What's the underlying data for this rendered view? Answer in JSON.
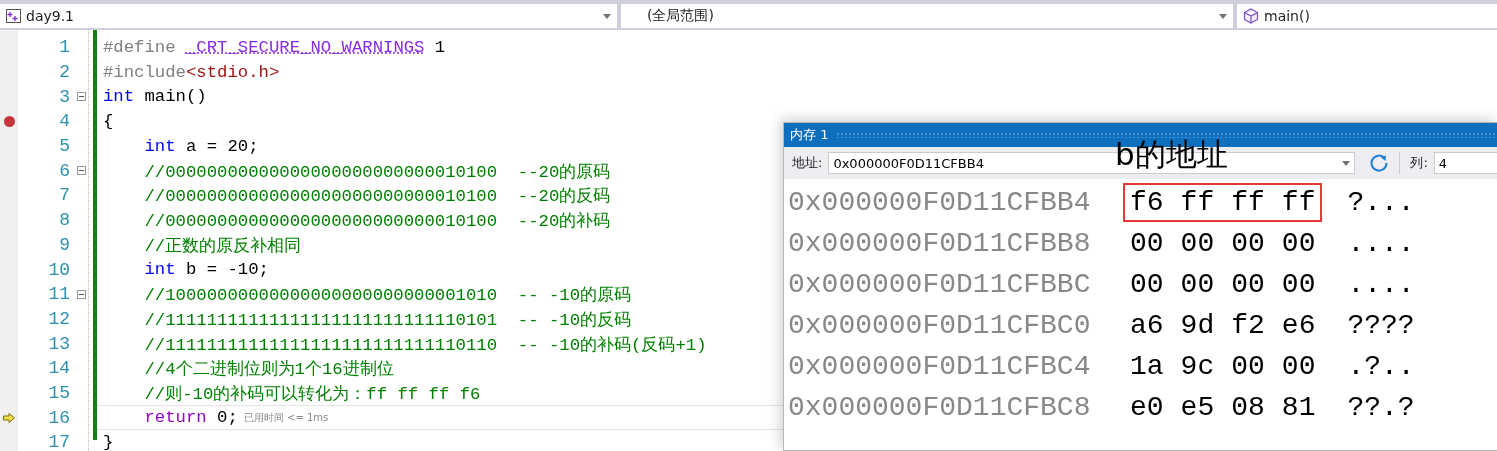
{
  "navigation_bar": {
    "project": "day9.1",
    "scope": "(全局范围)",
    "function": "main()"
  },
  "editor": {
    "lines": [
      {
        "number": "1",
        "breakpoint": false,
        "current": false,
        "foldable": false,
        "segments": [
          {
            "text": "#define ",
            "kind": "preprocessor"
          },
          {
            "text": "_CRT_SECURE_NO_WARNINGS",
            "kind": "macro"
          },
          {
            "text": " 1",
            "kind": "plain"
          }
        ]
      },
      {
        "number": "2",
        "breakpoint": false,
        "current": false,
        "foldable": false,
        "segments": [
          {
            "text": "#include",
            "kind": "preprocessor"
          },
          {
            "text": "<stdio.h>",
            "kind": "string"
          }
        ]
      },
      {
        "number": "3",
        "breakpoint": false,
        "current": false,
        "foldable": true,
        "segments": [
          {
            "text": "int",
            "kind": "keyword"
          },
          {
            "text": " main()",
            "kind": "plain"
          }
        ]
      },
      {
        "number": "4",
        "breakpoint": true,
        "current": false,
        "foldable": false,
        "segments": [
          {
            "text": "{",
            "kind": "plain"
          }
        ]
      },
      {
        "number": "5",
        "breakpoint": false,
        "current": false,
        "foldable": false,
        "segments": [
          {
            "text": "    int",
            "kind": "keyword"
          },
          {
            "text": " a = 20;",
            "kind": "plain"
          }
        ]
      },
      {
        "number": "6",
        "breakpoint": false,
        "current": false,
        "foldable": true,
        "segments": [
          {
            "text": "    //00000000000000000000000000010100  --20的原码",
            "kind": "comment"
          }
        ]
      },
      {
        "number": "7",
        "breakpoint": false,
        "current": false,
        "foldable": false,
        "segments": [
          {
            "text": "    //00000000000000000000000000010100  --20的反码",
            "kind": "comment"
          }
        ]
      },
      {
        "number": "8",
        "breakpoint": false,
        "current": false,
        "foldable": false,
        "segments": [
          {
            "text": "    //00000000000000000000000000010100  --20的补码",
            "kind": "comment"
          }
        ]
      },
      {
        "number": "9",
        "breakpoint": false,
        "current": false,
        "foldable": false,
        "segments": [
          {
            "text": "    //正数的原反补相同",
            "kind": "comment"
          }
        ]
      },
      {
        "number": "10",
        "breakpoint": false,
        "current": false,
        "foldable": false,
        "segments": [
          {
            "text": "    int",
            "kind": "keyword"
          },
          {
            "text": " b = -10;",
            "kind": "plain"
          }
        ]
      },
      {
        "number": "11",
        "breakpoint": false,
        "current": false,
        "foldable": true,
        "segments": [
          {
            "text": "    //10000000000000000000000000001010  -- -10的原码",
            "kind": "comment"
          }
        ]
      },
      {
        "number": "12",
        "breakpoint": false,
        "current": false,
        "foldable": false,
        "segments": [
          {
            "text": "    //11111111111111111111111111110101  -- -10的反码",
            "kind": "comment"
          }
        ]
      },
      {
        "number": "13",
        "breakpoint": false,
        "current": false,
        "foldable": false,
        "segments": [
          {
            "text": "    //11111111111111111111111111110110  -- -10的补码(反码+1)",
            "kind": "comment"
          }
        ]
      },
      {
        "number": "14",
        "breakpoint": false,
        "current": false,
        "foldable": false,
        "segments": [
          {
            "text": "    //4个二进制位则为1个16进制位",
            "kind": "comment"
          }
        ]
      },
      {
        "number": "15",
        "breakpoint": false,
        "current": false,
        "foldable": false,
        "segments": [
          {
            "text": "    //则-10的补码可以转化为：ff ff ff f6",
            "kind": "comment"
          }
        ]
      },
      {
        "number": "16",
        "breakpoint": false,
        "current": true,
        "foldable": false,
        "hint": "已用时间 <= 1ms",
        "segments": [
          {
            "text": "    return",
            "kind": "control"
          },
          {
            "text": " 0;",
            "kind": "plain"
          }
        ]
      },
      {
        "number": "17",
        "breakpoint": false,
        "current": false,
        "foldable": false,
        "segments": [
          {
            "text": "}",
            "kind": "plain"
          }
        ]
      }
    ]
  },
  "memory_window": {
    "title": "内存 1",
    "address_label": "地址:",
    "address": "0x000000F0D11CFBB4",
    "columns_label": "列:",
    "columns": "4",
    "rows": [
      {
        "address": "0x000000F0D11CFBB4",
        "bytes": [
          "f6",
          "ff",
          "ff",
          "ff"
        ],
        "ascii": "?...",
        "highlighted": true
      },
      {
        "address": "0x000000F0D11CFBB8",
        "bytes": [
          "00",
          "00",
          "00",
          "00"
        ],
        "ascii": "....",
        "highlighted": false
      },
      {
        "address": "0x000000F0D11CFBBC",
        "bytes": [
          "00",
          "00",
          "00",
          "00"
        ],
        "ascii": "....",
        "highlighted": false
      },
      {
        "address": "0x000000F0D11CFBC0",
        "bytes": [
          "a6",
          "9d",
          "f2",
          "e6"
        ],
        "ascii": "????",
        "highlighted": false
      },
      {
        "address": "0x000000F0D11CFBC4",
        "bytes": [
          "1a",
          "9c",
          "00",
          "00"
        ],
        "ascii": ".?..",
        "highlighted": false
      },
      {
        "address": "0x000000F0D11CFBC8",
        "bytes": [
          "e0",
          "e5",
          "08",
          "81"
        ],
        "ascii": "??.?",
        "highlighted": false
      }
    ]
  },
  "annotation": "b的地址"
}
